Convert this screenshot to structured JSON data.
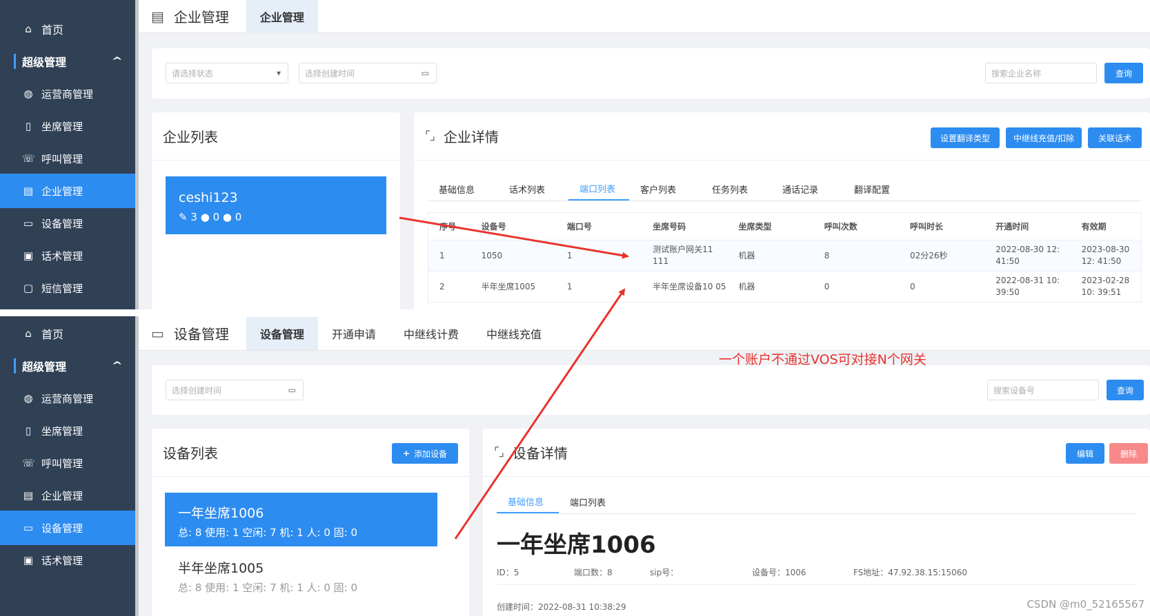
{
  "colors": {
    "sidebar_bg": "#304156",
    "primary": "#2d8cf0",
    "danger": "#f78989",
    "annotation": "#e8332e"
  },
  "top_panel": {
    "sidebar": {
      "home": "首页",
      "group": "超级管理",
      "items": [
        "运营商管理",
        "坐席管理",
        "呼叫管理",
        "企业管理",
        "设备管理",
        "话术管理",
        "短信管理"
      ],
      "active": "企业管理"
    },
    "header": {
      "title": "企业管理",
      "tabs": [
        "企业管理"
      ]
    },
    "filter": {
      "status_placeholder": "请选择状态",
      "date_placeholder": "选择创建时间",
      "search_placeholder": "搜索企业名称",
      "query_button": "查询"
    },
    "list": {
      "title": "企业列表",
      "items": [
        {
          "name": "ceshi123",
          "stat1": "3",
          "stat2": "0",
          "stat3": "0"
        }
      ]
    },
    "detail": {
      "title": "企业详情",
      "buttons": [
        "设置翻译类型",
        "中继线充值/扣除",
        "关联话术"
      ],
      "tabs": [
        "基础信息",
        "话术列表",
        "端口列表",
        "客户列表",
        "任务列表",
        "通话记录",
        "翻译配置"
      ],
      "active_tab": "端口列表",
      "table": {
        "headers": [
          "序号",
          "设备号",
          "端口号",
          "坐席号码",
          "坐席类型",
          "呼叫次数",
          "呼叫时长",
          "开通时间",
          "有效期"
        ],
        "rows": [
          [
            "1",
            "1050",
            "1",
            "测试账户网关11 111",
            "机器",
            "8",
            "02分26秒",
            "2022-08-30 12: 41:50",
            "2023-08-30 12: 41:50"
          ],
          [
            "2",
            "半年坐席1005",
            "1",
            "半年坐席设备10 05",
            "机器",
            "0",
            "0",
            "2022-08-31 10: 39:50",
            "2023-02-28 10: 39:51"
          ]
        ]
      }
    }
  },
  "bottom_panel": {
    "sidebar": {
      "home": "首页",
      "group": "超级管理",
      "items": [
        "运营商管理",
        "坐席管理",
        "呼叫管理",
        "企业管理",
        "设备管理",
        "话术管理"
      ],
      "active": "设备管理"
    },
    "header": {
      "title": "设备管理",
      "tabs": [
        "设备管理",
        "开通申请",
        "中继线计费",
        "中继线充值"
      ]
    },
    "filter": {
      "date_placeholder": "选择创建时间",
      "search_placeholder": "搜索设备号",
      "query_button": "查询"
    },
    "list": {
      "title": "设备列表",
      "add_button": "添加设备",
      "items": [
        {
          "name": "一年坐席1006",
          "stats": "总: 8 使用: 1 空闲: 7 机: 1 人: 0 固: 0"
        },
        {
          "name": "半年坐席1005",
          "stats": "总: 8 使用: 1 空闲: 7 机: 1 人: 0 固: 0"
        }
      ]
    },
    "detail": {
      "title": "设备详情",
      "edit_button": "编辑",
      "delete_button": "删除",
      "tabs": [
        "基础信息",
        "端口列表"
      ],
      "active_tab": "基础信息",
      "device_name": "一年坐席1006",
      "info": {
        "id": "ID：5",
        "ports": "端口数：8",
        "sip": "sip号：",
        "device_no": "设备号：1006",
        "fs": "FS地址：47.92.38.15:15060",
        "created": "创建时间：2022-08-31 10:38:29"
      }
    }
  },
  "annotation": "一个账户不通过VOS可对接N个网关",
  "watermark": "CSDN @m0_52165567"
}
